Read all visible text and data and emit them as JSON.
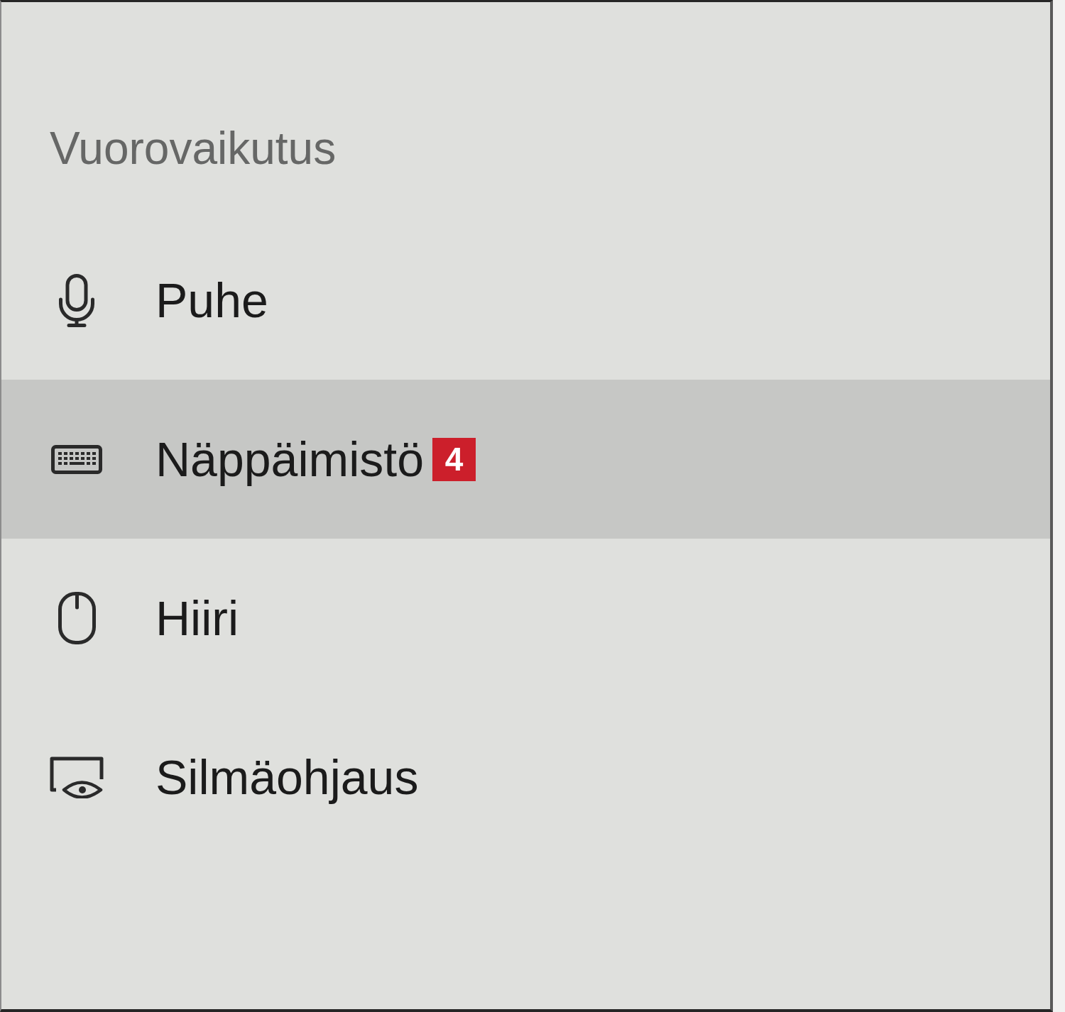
{
  "sidebar": {
    "heading": "Vuorovaikutus",
    "items": [
      {
        "label": "Puhe",
        "selected": false
      },
      {
        "label": "Näppäimistö",
        "selected": true,
        "badge": "4"
      },
      {
        "label": "Hiiri",
        "selected": false
      },
      {
        "label": "Silmäohjaus",
        "selected": false
      }
    ]
  }
}
